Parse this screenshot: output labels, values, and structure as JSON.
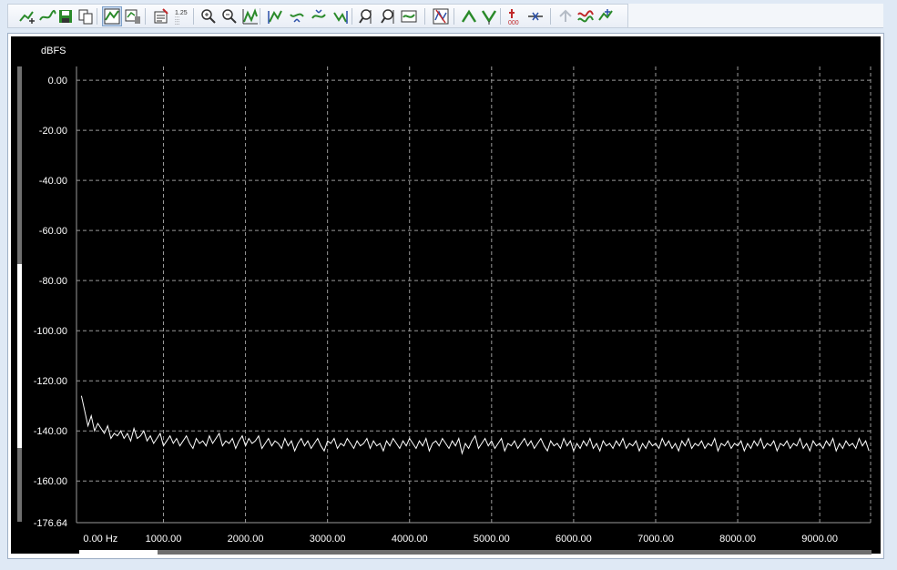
{
  "toolbar": {
    "buttons": [
      {
        "name": "add-curve-icon"
      },
      {
        "name": "smooth-curve-icon"
      },
      {
        "name": "save-icon"
      },
      {
        "name": "copy-icon"
      },
      {
        "name": "chart-view-icon",
        "active": true
      },
      {
        "name": "chart-settings-icon"
      },
      {
        "name": "properties-icon"
      },
      {
        "name": "numeric-scale-icon"
      },
      {
        "name": "zoom-in-icon"
      },
      {
        "name": "zoom-out-icon"
      },
      {
        "name": "zoom-fit-icon"
      },
      {
        "name": "cursor-left-icon"
      },
      {
        "name": "cursor-down-icon"
      },
      {
        "name": "cursor-up-icon"
      },
      {
        "name": "cursor-right-icon"
      },
      {
        "name": "zoom-x-icon"
      },
      {
        "name": "zoom-y-icon"
      },
      {
        "name": "auto-scale-icon"
      },
      {
        "name": "trace-icon"
      },
      {
        "name": "peak-up-icon"
      },
      {
        "name": "peak-down-icon"
      },
      {
        "name": "marker-icon"
      },
      {
        "name": "link-icon"
      },
      {
        "name": "undo-icon",
        "disabled": true
      },
      {
        "name": "waveform-icon"
      },
      {
        "name": "export-icon"
      }
    ],
    "colors": {
      "accent": "#2a8a2a",
      "red": "#c0282a",
      "blue": "#2a4fa8"
    }
  },
  "chart_data": {
    "type": "line",
    "ylabel": "dBFS",
    "xlabel": "",
    "ylim": [
      -176.64,
      5.5
    ],
    "xlim": [
      -60,
      9620
    ],
    "y_ticks": [
      "0.00",
      "-20.00",
      "-40.00",
      "-60.00",
      "-80.00",
      "-100.00",
      "-120.00",
      "-140.00",
      "-160.00",
      "-176.64"
    ],
    "x_ticks": [
      "0.00 Hz",
      "1000.00",
      "2000.00",
      "3000.00",
      "4000.00",
      "5000.00",
      "6000.00",
      "7000.00",
      "8000.00",
      "9000.00"
    ],
    "grid": true,
    "series": [
      {
        "color": "#ffffff",
        "x_start": 0,
        "x_step": 40,
        "values": [
          -126,
          -132,
          -138,
          -134,
          -140,
          -137,
          -139,
          -141,
          -138,
          -143,
          -141,
          -142,
          -140,
          -143,
          -141,
          -144,
          -139,
          -143,
          -142,
          -140,
          -144,
          -142,
          -145,
          -143,
          -141,
          -146,
          -144,
          -142,
          -145,
          -143,
          -146,
          -144,
          -142,
          -145,
          -147,
          -143,
          -145,
          -144,
          -146,
          -142,
          -145,
          -143,
          -141,
          -146,
          -144,
          -145,
          -143,
          -147,
          -144,
          -142,
          -146,
          -143,
          -145,
          -144,
          -142,
          -147,
          -145,
          -143,
          -146,
          -144,
          -145,
          -147,
          -143,
          -146,
          -144,
          -148,
          -145,
          -143,
          -146,
          -144,
          -147,
          -145,
          -143,
          -146,
          -148,
          -144,
          -145,
          -143,
          -147,
          -145,
          -146,
          -143,
          -145,
          -147,
          -144,
          -146,
          -145,
          -143,
          -147,
          -144,
          -146,
          -145,
          -148,
          -144,
          -146,
          -143,
          -145,
          -147,
          -144,
          -146,
          -143,
          -145,
          -147,
          -144,
          -146,
          -143,
          -148,
          -145,
          -144,
          -146,
          -143,
          -145,
          -147,
          -144,
          -146,
          -143,
          -149,
          -145,
          -147,
          -144,
          -142,
          -147,
          -145,
          -143,
          -146,
          -144,
          -147,
          -145,
          -143,
          -148,
          -145,
          -146,
          -144,
          -147,
          -145,
          -143,
          -146,
          -144,
          -147,
          -145,
          -143,
          -146,
          -148,
          -144,
          -146,
          -145,
          -147,
          -143,
          -146,
          -144,
          -148,
          -145,
          -147,
          -144,
          -146,
          -143,
          -147,
          -145,
          -148,
          -144,
          -146,
          -145,
          -147,
          -144,
          -146,
          -143,
          -147,
          -145,
          -146,
          -144,
          -148,
          -145,
          -147,
          -144,
          -146,
          -145,
          -147,
          -143,
          -146,
          -144,
          -147,
          -145,
          -148,
          -144,
          -146,
          -143,
          -147,
          -145,
          -146,
          -144,
          -147,
          -145,
          -146,
          -143,
          -148,
          -145,
          -146,
          -144,
          -147,
          -145,
          -146,
          -144,
          -148,
          -145,
          -147,
          -144,
          -146,
          -143,
          -147,
          -145,
          -146,
          -144,
          -148,
          -145,
          -146,
          -144,
          -147,
          -145,
          -146,
          -143,
          -147,
          -145,
          -148,
          -144,
          -146,
          -145,
          -147,
          -144,
          -146,
          -143,
          -148,
          -145,
          -147,
          -144,
          -146,
          -145,
          -147,
          -143,
          -146,
          -144,
          -148
        ]
      }
    ]
  }
}
